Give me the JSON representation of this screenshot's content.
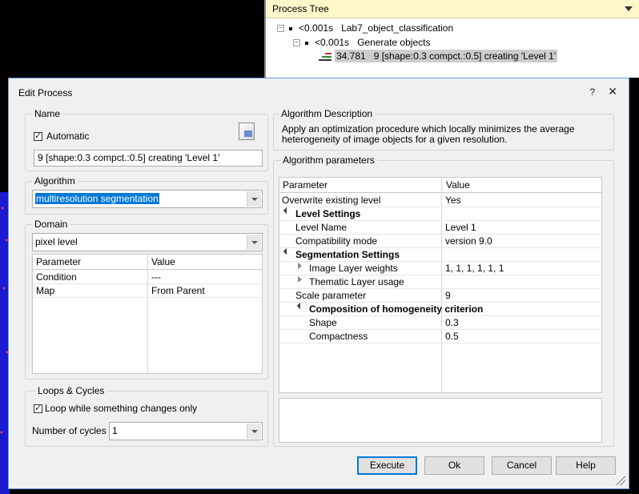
{
  "process_tree": {
    "title": "Process Tree",
    "rows": [
      {
        "time": "<0.001s",
        "label": "Lab7_object_classification"
      },
      {
        "time": "<0.001s",
        "label": "Generate objects"
      },
      {
        "time": "34.781",
        "label": "9 [shape:0.3 compct.:0.5] creating 'Level 1'"
      }
    ]
  },
  "dialog": {
    "title": "Edit Process",
    "help": "?",
    "close": "✕",
    "name_group": {
      "label": "Name",
      "automatic_label": "Automatic",
      "automatic_checked": true,
      "name_value": "9 [shape:0.3 compct.:0.5] creating 'Level 1'"
    },
    "algorithm_group": {
      "label": "Algorithm",
      "selected": "multiresolution segmentation"
    },
    "domain_group": {
      "label": "Domain",
      "selected": "pixel level",
      "columns": [
        "Parameter",
        "Value"
      ],
      "rows": [
        {
          "param": "Condition",
          "value": "---"
        },
        {
          "param": "Map",
          "value": "From Parent"
        }
      ]
    },
    "loops_group": {
      "label": "Loops & Cycles",
      "loop_label": "Loop while something changes only",
      "loop_checked": true,
      "cycles_label": "Number of cycles",
      "cycles_value": "1"
    },
    "description_group": {
      "label": "Algorithm Description",
      "text": "Apply an optimization procedure which locally minimizes the average heterogeneity of image objects for a given resolution."
    },
    "parameters_group": {
      "label": "Algorithm parameters",
      "columns": [
        "Parameter",
        "Value"
      ],
      "rows": [
        {
          "param": "Overwrite existing level",
          "value": "Yes",
          "style": "plain",
          "indent": 0
        },
        {
          "param": "Level Settings",
          "value": "",
          "style": "section",
          "indent": 1
        },
        {
          "param": "Level Name",
          "value": "Level 1",
          "style": "plain",
          "indent": 1
        },
        {
          "param": "Compatibility mode",
          "value": "version 9.0",
          "style": "plain",
          "indent": 1
        },
        {
          "param": "Segmentation Settings",
          "value": "",
          "style": "section",
          "indent": 1
        },
        {
          "param": "Image Layer weights",
          "value": "1, 1, 1, 1, 1, 1",
          "style": "collapsed",
          "indent": 2
        },
        {
          "param": "Thematic Layer usage",
          "value": "",
          "style": "collapsed",
          "indent": 2
        },
        {
          "param": "Scale parameter",
          "value": "9",
          "style": "plain",
          "indent": 1
        },
        {
          "param": "Composition of homogeneity criterion",
          "value": "",
          "style": "section",
          "indent": 2
        },
        {
          "param": "Shape",
          "value": "0.3",
          "style": "plain",
          "indent": 2
        },
        {
          "param": "Compactness",
          "value": "0.5",
          "style": "plain",
          "indent": 2
        }
      ]
    },
    "buttons": {
      "execute": "Execute",
      "ok": "Ok",
      "cancel": "Cancel",
      "help": "Help"
    }
  }
}
